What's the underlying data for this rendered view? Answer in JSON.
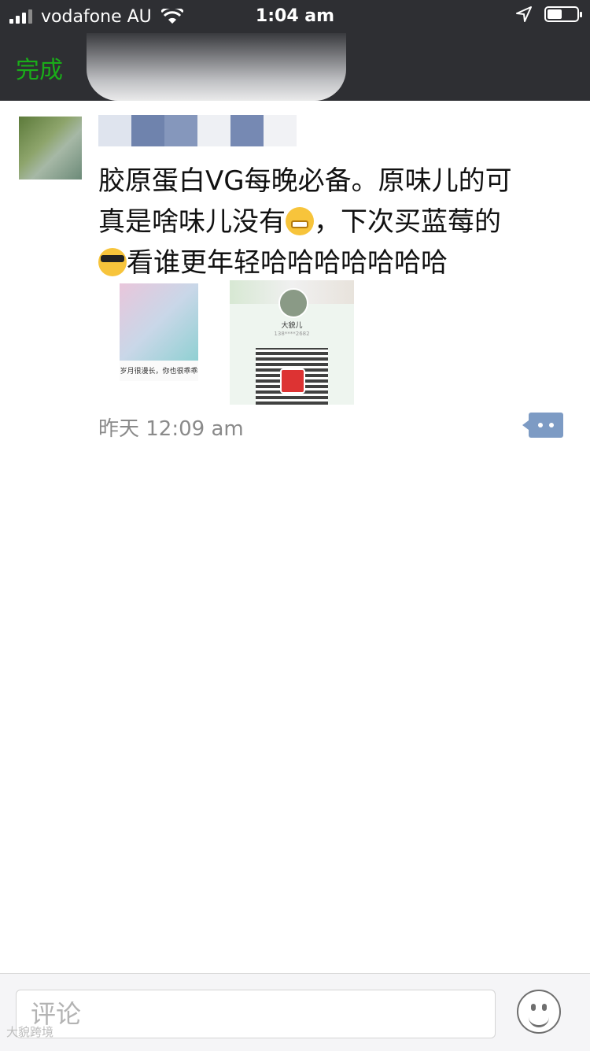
{
  "status_bar": {
    "carrier": "vodafone AU",
    "time": "1:04 am"
  },
  "nav": {
    "done_label": "完成"
  },
  "post": {
    "text_line1": "胶原蛋白VG每晚必备。原味儿的可",
    "text_line2a": "真是啥味儿没有",
    "text_line2b": "，下次买蓝莓的",
    "text_line3": "看谁更年轻哈哈哈哈哈哈哈",
    "photo1_caption": "岁月很漫长，你也很乖乖",
    "photo2_name": "大貌儿",
    "photo2_number": "138****2682",
    "timestamp": "昨天 12:09 am"
  },
  "comment_bar": {
    "placeholder": "评论"
  },
  "watermark": "大貌跨境",
  "colors": {
    "nav_bg": "#2e2f33",
    "accent_green": "#1aad19",
    "comment_icon": "#7d9bc4"
  }
}
